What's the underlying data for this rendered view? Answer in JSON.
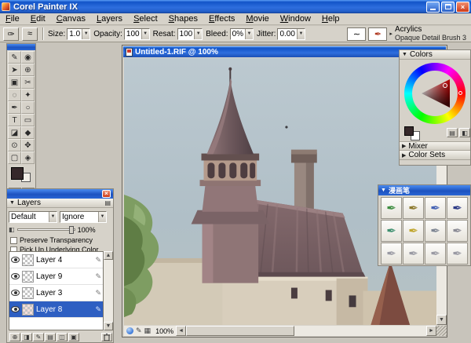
{
  "window": {
    "title": "Corel Painter IX"
  },
  "menubar": {
    "items": [
      "File",
      "Edit",
      "Canvas",
      "Layers",
      "Select",
      "Shapes",
      "Effects",
      "Movie",
      "Window",
      "Help"
    ]
  },
  "propbar": {
    "fields": [
      {
        "label": "Size:",
        "value": "1.0"
      },
      {
        "label": "Opacity:",
        "value": "100"
      },
      {
        "label": "Resat:",
        "value": "100"
      },
      {
        "label": "Bleed:",
        "value": "0%"
      },
      {
        "label": "Jitter:",
        "value": "0.00"
      }
    ],
    "brush_selector": {
      "category": "Acrylics",
      "variant": "Opaque Detail Brush 3"
    }
  },
  "document": {
    "title": "Untitled-1.RIF @ 100%",
    "zoom": "100%"
  },
  "colors_panel": {
    "title": "Colors",
    "mixer_label": "Mixer",
    "color_sets_label": "Color Sets",
    "primary_color": "#35282a",
    "secondary_color": "#ffffff"
  },
  "brush_palette": {
    "title": "漫画笔",
    "pens": [
      {
        "name": "pen-green",
        "color": "#3e8e41"
      },
      {
        "name": "pen-olive",
        "color": "#8d7a2e"
      },
      {
        "name": "pen-blue",
        "color": "#4663b4"
      },
      {
        "name": "pen-navy",
        "color": "#2c3a86"
      },
      {
        "name": "pen-teal",
        "color": "#3f9070"
      },
      {
        "name": "pen-yellow",
        "color": "#c0a62f"
      },
      {
        "name": "pen-gray-1",
        "color": "#7e8693"
      },
      {
        "name": "pen-gray-2",
        "color": "#8b8b95"
      },
      {
        "name": "pen-gray-3",
        "color": "#9a9aa4"
      },
      {
        "name": "pen-gray-4",
        "color": "#9a9aa4"
      },
      {
        "name": "pen-gray-5",
        "color": "#9a9aa4"
      },
      {
        "name": "pen-gray-6",
        "color": "#9a9aa4"
      }
    ]
  },
  "layers_panel": {
    "header": "Layers",
    "composite_method": "Default",
    "composite_depth": "Ignore",
    "opacity_value": "100%",
    "checkbox_preserve": "Preserve Transparency",
    "checkbox_pickup": "Pick Up Underlying Color",
    "layers": [
      {
        "name": "Layer 4"
      },
      {
        "name": "Layer 9"
      },
      {
        "name": "Layer 3"
      },
      {
        "name": "Layer 8"
      }
    ],
    "selection_color": "#2e5fc2"
  },
  "toolbox": {
    "tools": [
      {
        "name": "brush-tool",
        "glyph": "✎"
      },
      {
        "name": "rotate-page-tool",
        "glyph": "◉"
      },
      {
        "name": "layer-adjuster-tool",
        "glyph": "➤"
      },
      {
        "name": "magnifier-tool",
        "glyph": "⊕"
      },
      {
        "name": "crop-tool",
        "glyph": "▣"
      },
      {
        "name": "scissors-tool",
        "glyph": "✂"
      },
      {
        "name": "lasso-tool",
        "glyph": "◌"
      },
      {
        "name": "magic-wand-tool",
        "glyph": "✦"
      },
      {
        "name": "pen-tool",
        "glyph": "✒"
      },
      {
        "name": "oval-shape-tool",
        "glyph": "○"
      },
      {
        "name": "text-tool",
        "glyph": "T"
      },
      {
        "name": "rect-shape-tool",
        "glyph": "▭"
      },
      {
        "name": "dropper-tool",
        "glyph": "◪"
      },
      {
        "name": "paint-bucket-tool",
        "glyph": "◆"
      },
      {
        "name": "zoom-tool",
        "glyph": "⊙"
      },
      {
        "name": "grabber-tool",
        "glyph": "✥"
      },
      {
        "name": "selection-tool",
        "glyph": "▢"
      },
      {
        "name": "shape-select-tool",
        "glyph": "◈"
      }
    ],
    "papers": [
      {
        "name": "paper-swatch-1",
        "color": "#7a5c3a"
      },
      {
        "name": "paper-swatch-2",
        "color": "#d8d4cc"
      },
      {
        "name": "paper-swatch-3",
        "color": "#b0a890"
      },
      {
        "name": "paper-swatch-4",
        "color": "#888070"
      },
      {
        "name": "paper-swatch-5",
        "color": "#c8c0a8"
      },
      {
        "name": "paper-swatch-6",
        "color": "#5a5248"
      }
    ],
    "primary_color": "#35282a",
    "secondary_color": "#f2efe8"
  }
}
